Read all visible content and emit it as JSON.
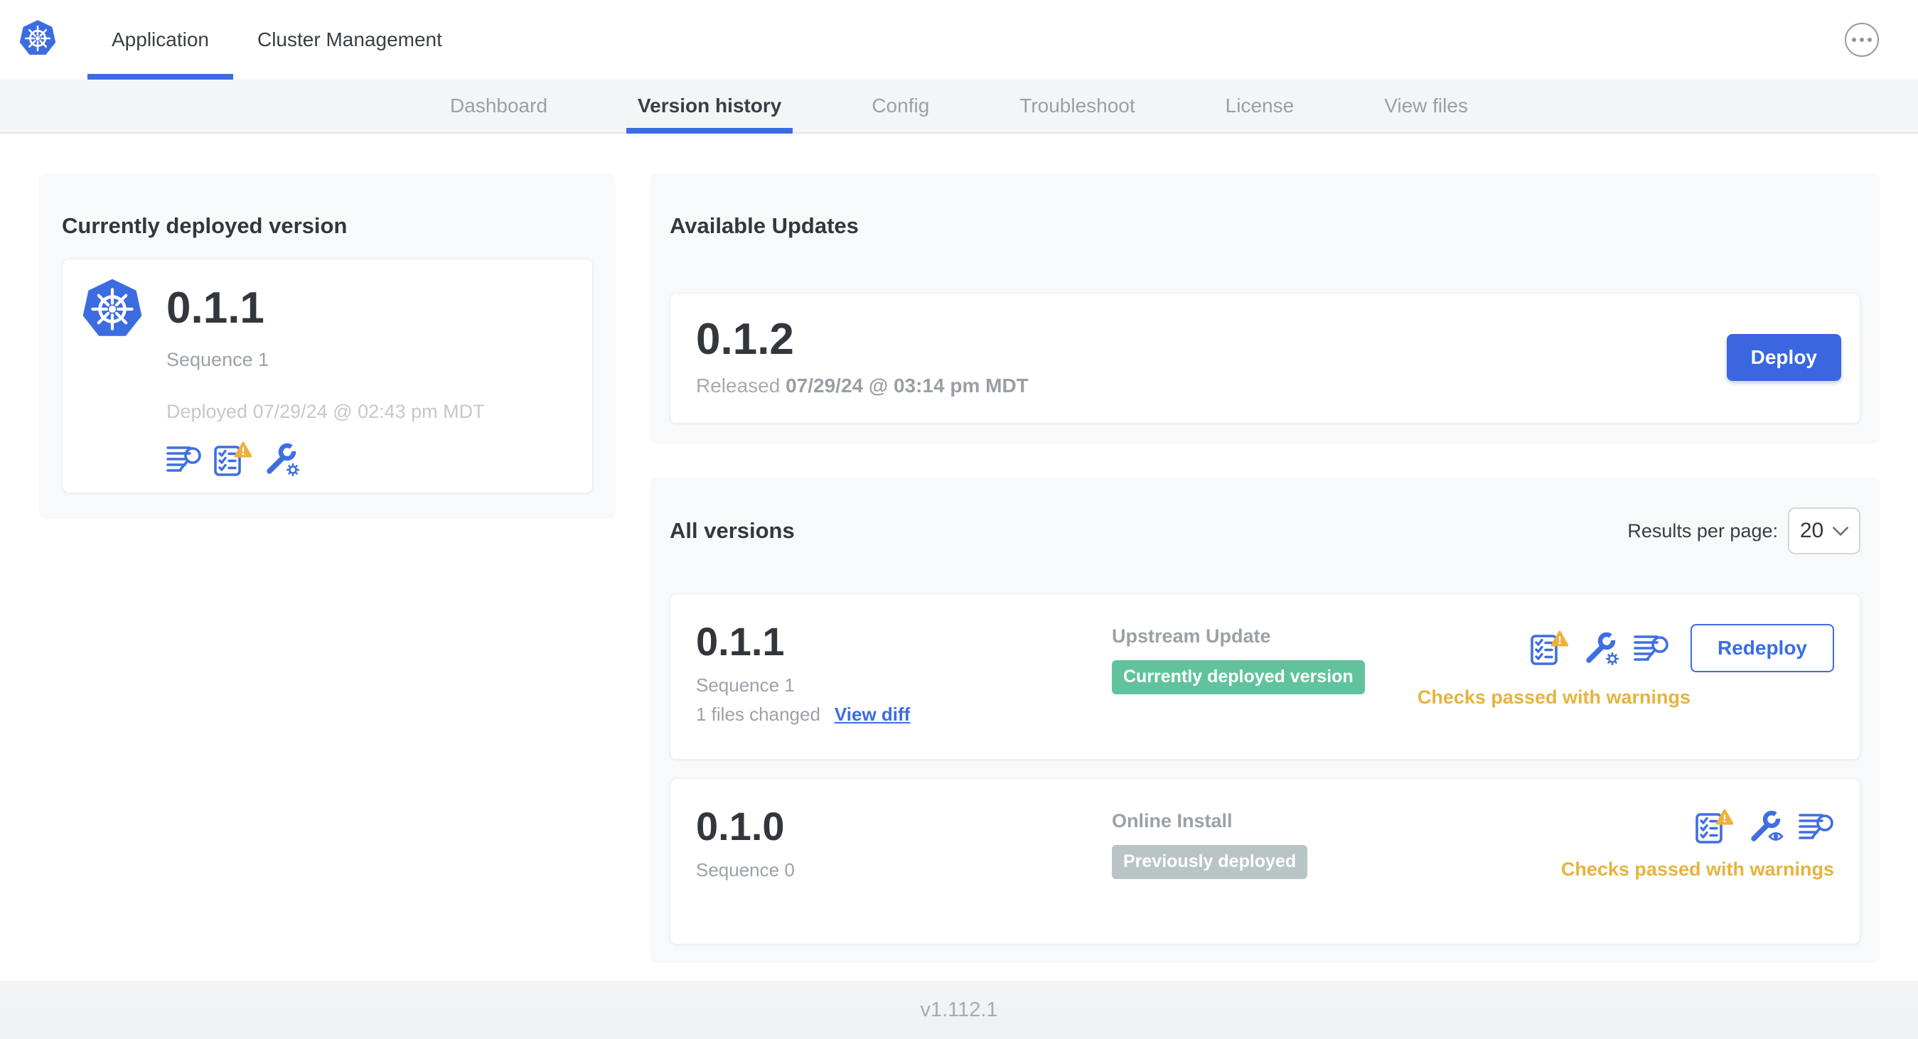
{
  "topnav": {
    "tabs": [
      {
        "label": "Application",
        "active": true
      },
      {
        "label": "Cluster Management",
        "active": false
      }
    ]
  },
  "subnav": {
    "tabs": [
      "Dashboard",
      "Version history",
      "Config",
      "Troubleshoot",
      "License",
      "View files"
    ],
    "active_tab": "Version history"
  },
  "current": {
    "title": "Currently deployed version",
    "version": "0.1.1",
    "sequence": "Sequence 1",
    "deployed": "Deployed 07/29/24 @ 02:43 pm MDT"
  },
  "available": {
    "title": "Available Updates",
    "version": "0.1.2",
    "released_prefix": "Released",
    "released_date": "07/29/24 @ 03:14 pm MDT",
    "deploy_label": "Deploy"
  },
  "all_versions": {
    "title": "All versions",
    "results_per_page_label": "Results per page:",
    "results_per_page_value": "20",
    "rows": [
      {
        "version": "0.1.1",
        "sequence": "Sequence 1",
        "files_changed": "1 files changed",
        "view_diff": "View diff",
        "source": "Upstream Update",
        "badge": "Currently deployed version",
        "badge_type": "green",
        "status": "Checks passed with warnings",
        "action": "Redeploy"
      },
      {
        "version": "0.1.0",
        "sequence": "Sequence 0",
        "source": "Online Install",
        "badge": "Previously deployed",
        "badge_type": "gray",
        "status": "Checks passed with warnings"
      }
    ]
  },
  "footer": {
    "version": "v1.112.1"
  },
  "colors": {
    "accent_blue": "#3b6ce4",
    "icon_blue": "#3e6fe0",
    "badge_green": "#61c39e",
    "badge_gray": "#b9c4c6",
    "warning_amber": "#e8b33c",
    "subnav_bg": "#f4f5f7",
    "card_bg": "#f8f9fa"
  },
  "icon_names": [
    "kubernetes-logo",
    "ellipsis-menu-icon",
    "view-logs-icon",
    "preflight-checks-warning-icon",
    "edit-config-icon",
    "view-config-icon",
    "dropdown-chevron-icon",
    "warning-triangle-icon"
  ]
}
